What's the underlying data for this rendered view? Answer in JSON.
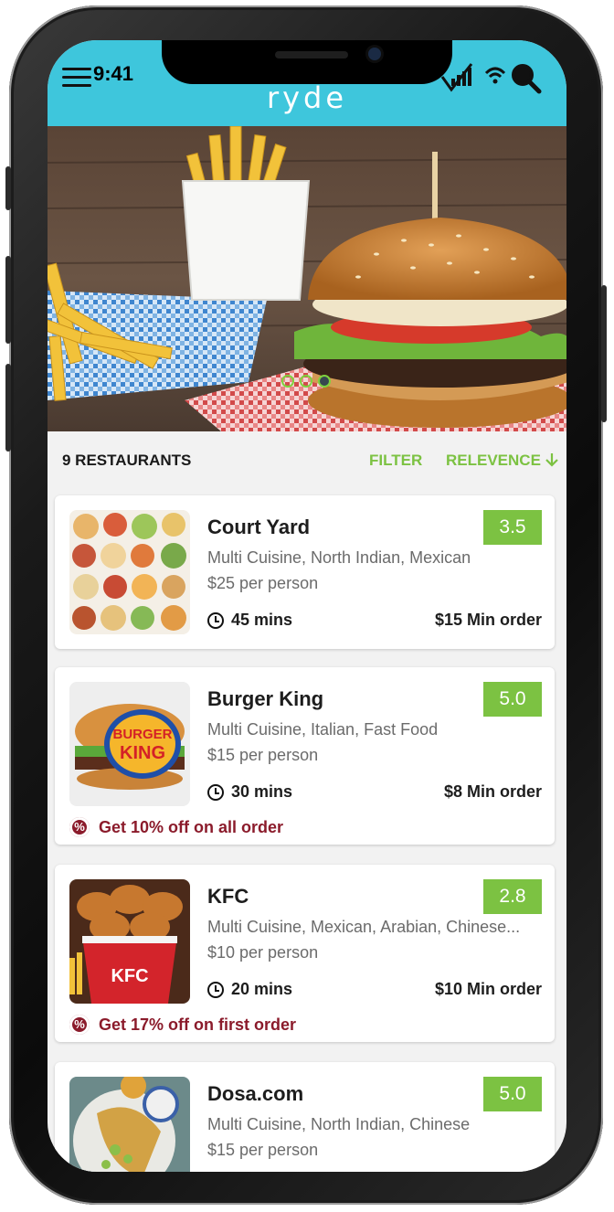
{
  "status_bar": {
    "time": "9:41"
  },
  "header": {
    "logo": "ryde",
    "accent_color": "#3ec6dc"
  },
  "carousel": {
    "slides": 3,
    "active_index": 2
  },
  "list_header": {
    "count": "9 RESTAURANTS",
    "filter": "FILTER",
    "sort": "RELEVENCE"
  },
  "restaurants": [
    {
      "name": "Court Yard",
      "cuisine": "Multi Cuisine, North Indian, Mexican",
      "price": "$25 per person",
      "rating": "3.5",
      "time": "45 mins",
      "min_order": "$15 Min order",
      "offer": ""
    },
    {
      "name": "Burger King",
      "cuisine": "Multi Cuisine, Italian, Fast Food",
      "price": "$15 per person",
      "rating": "5.0",
      "time": "30 mins",
      "min_order": "$8 Min order",
      "offer": "Get 10% off on all order"
    },
    {
      "name": "KFC",
      "cuisine": "Multi Cuisine, Mexican, Arabian, Chinese...",
      "price": "$10 per person",
      "rating": "2.8",
      "time": "20 mins",
      "min_order": "$10 Min order",
      "offer": "Get 17% off on first order"
    },
    {
      "name": "Dosa.com",
      "cuisine": "Multi Cuisine, North Indian, Chinese",
      "price": "$15 per person",
      "rating": "5.0",
      "time": "",
      "min_order": "",
      "offer": ""
    }
  ],
  "colors": {
    "rating_green": "#7cc242",
    "offer_red": "#8b1b2b"
  }
}
